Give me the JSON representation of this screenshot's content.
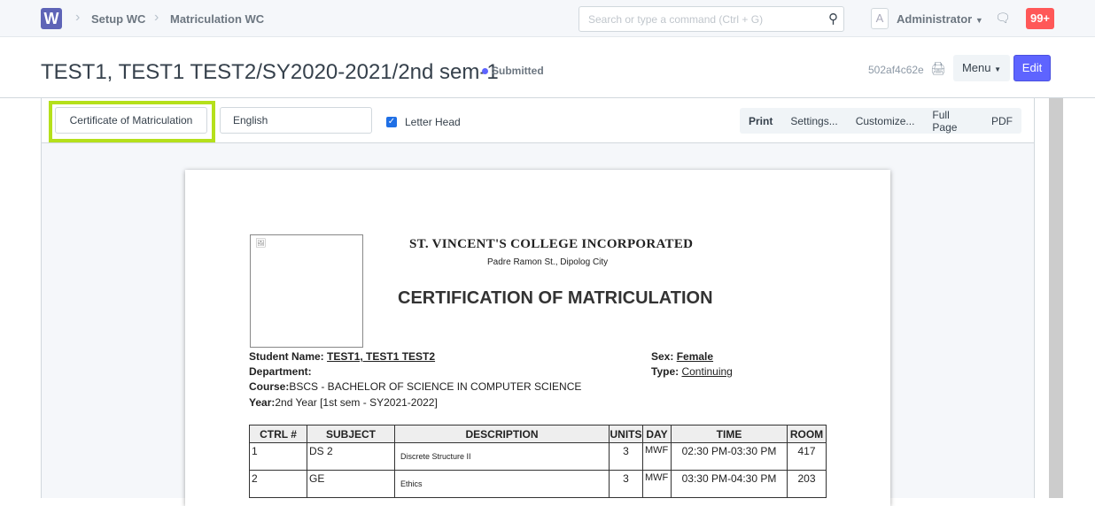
{
  "nav": {
    "logo": "W",
    "breadcrumbs": [
      "Setup WC",
      "Matriculation WC"
    ],
    "search_placeholder": "Search or type a command (Ctrl + G)",
    "avatar": "A",
    "user": "Administrator",
    "notifications": "99+"
  },
  "header": {
    "title": "TEST1, TEST1 TEST2/SY2020-2021/2nd sem-1",
    "status": "Submitted",
    "doc_id": "502af4c62e",
    "menu": "Menu",
    "edit": "Edit"
  },
  "toolbar": {
    "print_format": "Certificate of Matriculation",
    "language": "English",
    "letter_head": "Letter Head",
    "actions": [
      "Print",
      "Settings...",
      "Customize...",
      "Full Page",
      "PDF"
    ]
  },
  "doc": {
    "college": "ST. VINCENT'S COLLEGE INCORPORATED",
    "address": "Padre Ramon St., Dipolog City",
    "heading": "CERTIFICATION OF MATRICULATION",
    "student_label": "Student Name:",
    "student": "TEST1, TEST1 TEST2",
    "department_label": "Department:",
    "course_label": "Course:",
    "course": "BSCS - BACHELOR OF SCIENCE IN COMPUTER SCIENCE",
    "year_label": "Year:",
    "year": "2nd Year [1st sem - SY2021-2022]",
    "sex_label": "Sex:",
    "sex": "Female",
    "type_label": "Type:",
    "type": "Continuing",
    "columns": [
      "CTRL #",
      "SUBJECT",
      "DESCRIPTION",
      "UNITS",
      "DAY",
      "TIME",
      "ROOM"
    ],
    "rows": [
      [
        "1",
        "DS 2",
        "Discrete Structure II",
        "3",
        "MWF",
        "02:30 PM-03:30 PM",
        "417"
      ],
      [
        "2",
        "GE",
        "Ethics",
        "3",
        "MWF",
        "03:30 PM-04:30 PM",
        "203"
      ]
    ]
  }
}
